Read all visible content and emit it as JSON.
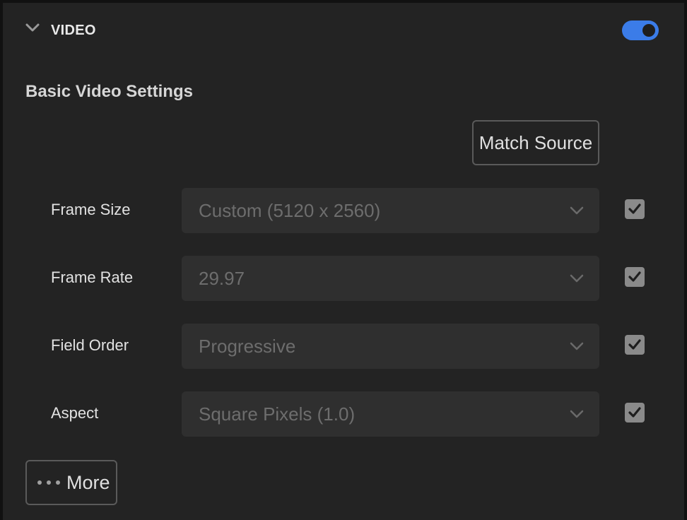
{
  "colors": {
    "accent": "#3b7ce8",
    "panel_bg": "#232323",
    "select_bg": "#2f2f2f",
    "checkbox_bg": "#8a8a8a"
  },
  "section": {
    "title": "VIDEO",
    "collapse_icon": "chevron-down-icon",
    "enabled": true
  },
  "basic": {
    "heading": "Basic Video Settings",
    "match_source_label": "Match Source"
  },
  "rows": [
    {
      "label": "Frame Size",
      "value": "Custom (5120 x 2560)",
      "checked": true
    },
    {
      "label": "Frame Rate",
      "value": "29.97",
      "checked": true
    },
    {
      "label": "Field Order",
      "value": "Progressive",
      "checked": true
    },
    {
      "label": "Aspect",
      "value": "Square Pixels (1.0)",
      "checked": true
    }
  ],
  "more": {
    "label": "More",
    "icon": "more-dots-icon"
  }
}
